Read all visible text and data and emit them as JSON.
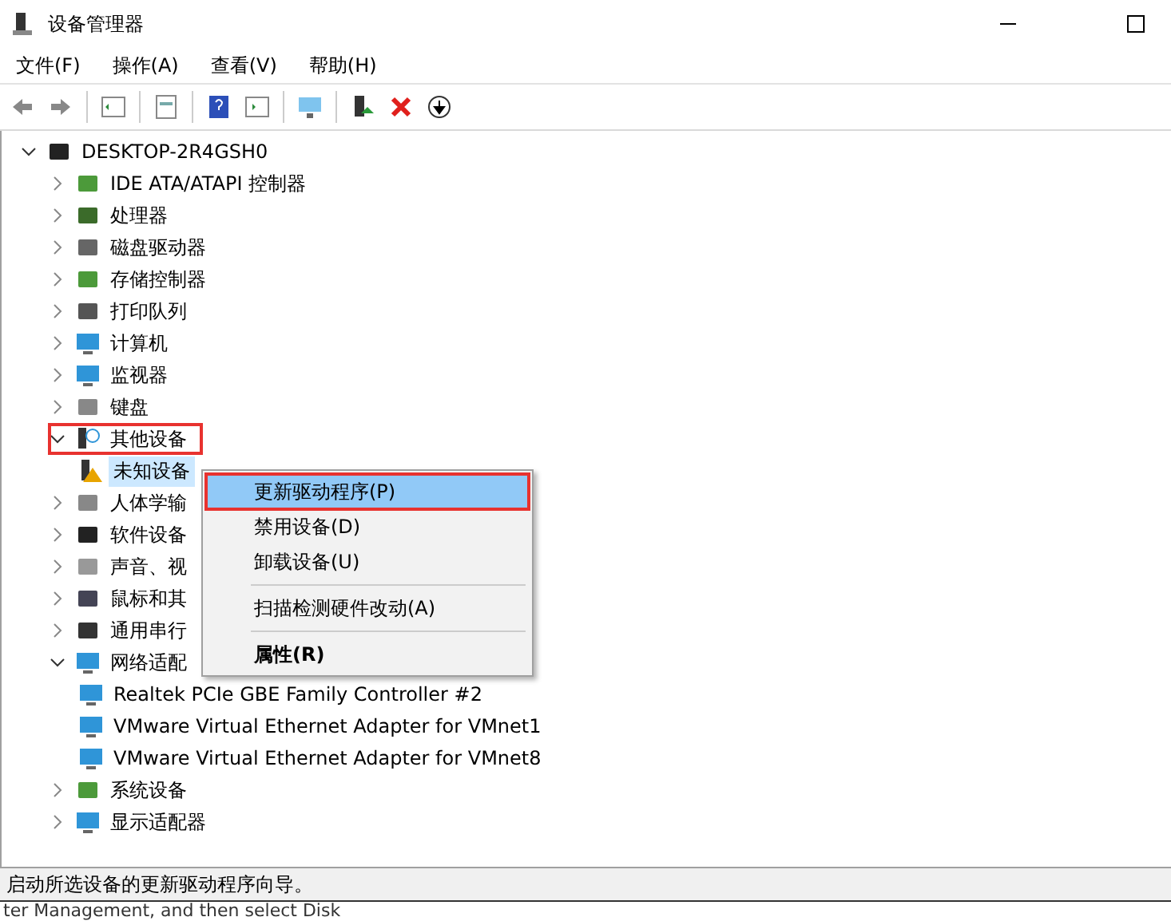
{
  "window": {
    "title": "设备管理器"
  },
  "menu_bar": [
    {
      "label": "文件(F)"
    },
    {
      "label": "操作(A)"
    },
    {
      "label": "查看(V)"
    },
    {
      "label": "帮助(H)"
    }
  ],
  "toolbar": [
    {
      "kind": "back"
    },
    {
      "kind": "forward"
    },
    {
      "kind": "sep"
    },
    {
      "kind": "console"
    },
    {
      "kind": "sep"
    },
    {
      "kind": "properties"
    },
    {
      "kind": "sep"
    },
    {
      "kind": "help"
    },
    {
      "kind": "action"
    },
    {
      "kind": "sep"
    },
    {
      "kind": "scan"
    },
    {
      "kind": "sep"
    },
    {
      "kind": "update"
    },
    {
      "kind": "remove"
    },
    {
      "kind": "download"
    }
  ],
  "tree": {
    "label": "DESKTOP-2R4GSH0",
    "expanded": true,
    "children": [
      {
        "label": "IDE ATA/ATAPI 控制器",
        "kind": "card",
        "expanded": false,
        "selected": false,
        "highlighted": false
      },
      {
        "label": "处理器",
        "kind": "chip",
        "expanded": false,
        "selected": false,
        "highlighted": false
      },
      {
        "label": "磁盘驱动器",
        "kind": "disk",
        "expanded": false,
        "selected": false,
        "highlighted": false
      },
      {
        "label": "存储控制器",
        "kind": "card",
        "expanded": false,
        "selected": false,
        "highlighted": false
      },
      {
        "label": "打印队列",
        "kind": "printer",
        "expanded": false,
        "selected": false,
        "highlighted": false
      },
      {
        "label": "计算机",
        "kind": "monitor",
        "expanded": false,
        "selected": false,
        "highlighted": false
      },
      {
        "label": "监视器",
        "kind": "monitor",
        "expanded": false,
        "selected": false,
        "highlighted": false
      },
      {
        "label": "键盘",
        "kind": "keyboard",
        "expanded": false,
        "selected": false,
        "highlighted": false
      },
      {
        "label": "其他设备",
        "kind": "unknown",
        "expanded": true,
        "selected": false,
        "highlighted": true,
        "children": [
          {
            "label": "未知设备",
            "kind": "warning",
            "selected": true,
            "highlighted": false
          }
        ]
      },
      {
        "label": "人体学输",
        "kind": "keyboard",
        "expanded": false,
        "selected": false,
        "highlighted": false
      },
      {
        "label": "软件设备",
        "kind": "tower",
        "expanded": false,
        "selected": false,
        "highlighted": false
      },
      {
        "label": "声音、视",
        "kind": "speaker",
        "expanded": false,
        "selected": false,
        "highlighted": false
      },
      {
        "label": "鼠标和其",
        "kind": "mouse",
        "expanded": false,
        "selected": false,
        "highlighted": false
      },
      {
        "label": "通用串行",
        "kind": "usb",
        "expanded": false,
        "selected": false,
        "highlighted": false
      },
      {
        "label": "网络适配",
        "kind": "network",
        "expanded": true,
        "selected": false,
        "highlighted": false,
        "children": [
          {
            "label": "Realtek PCIe GBE Family Controller #2",
            "kind": "monitor",
            "selected": false,
            "highlighted": false
          },
          {
            "label": "VMware Virtual Ethernet Adapter for VMnet1",
            "kind": "netcard",
            "selected": false,
            "highlighted": false
          },
          {
            "label": "VMware Virtual Ethernet Adapter for VMnet8",
            "kind": "netcard",
            "selected": false,
            "highlighted": false
          }
        ]
      },
      {
        "label": "系统设备",
        "kind": "card",
        "expanded": false,
        "selected": false,
        "highlighted": false
      },
      {
        "label": "显示适配器",
        "kind": "monitor",
        "expanded": false,
        "selected": false,
        "highlighted": false
      }
    ]
  },
  "context_menu": [
    {
      "label": "更新驱动程序(P)",
      "kind": "item",
      "selected": true,
      "highlighted": true
    },
    {
      "label": "禁用设备(D)",
      "kind": "item",
      "selected": false,
      "highlighted": false
    },
    {
      "label": "卸载设备(U)",
      "kind": "item",
      "selected": false,
      "highlighted": false
    },
    {
      "kind": "separator"
    },
    {
      "label": "扫描检测硬件改动(A)",
      "kind": "item",
      "selected": false,
      "highlighted": false
    },
    {
      "kind": "separator"
    },
    {
      "label": "属性(R)",
      "kind": "bold",
      "selected": false,
      "highlighted": false
    }
  ],
  "status_bar": {
    "text": "启动所选设备的更新驱动程序向导。"
  },
  "background_text": "ter Management, and then select Disk"
}
